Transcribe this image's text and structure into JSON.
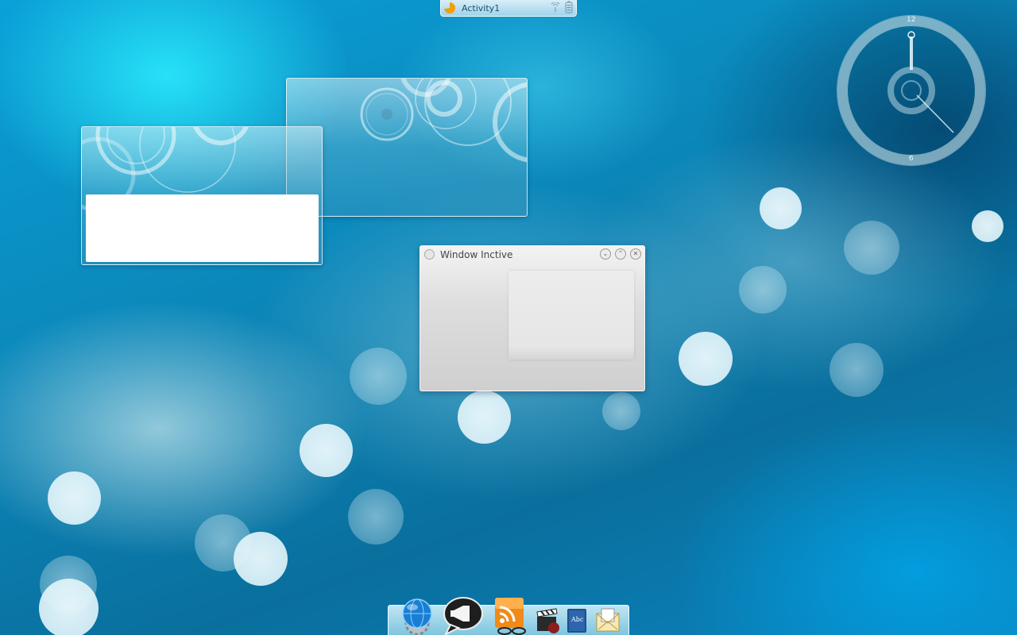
{
  "activity_bar": {
    "label": "Activity1",
    "icons": [
      "activity-switcher-icon",
      "network-icon",
      "battery-icon"
    ]
  },
  "clock": {
    "label_top": "12",
    "label_bottom": "6",
    "hands": {
      "hour": "12",
      "minute": "22"
    }
  },
  "windows": {
    "inactive": {
      "title": "Window Inctive",
      "buttons": [
        "minimize-icon",
        "maximize-icon",
        "close-icon"
      ]
    }
  },
  "dock": {
    "items": [
      "browser-globe-icon",
      "megaphone-chat-icon",
      "rss-feed-icon",
      "video-clapper-icon",
      "dictionary-book-icon",
      "mail-envelope-icon"
    ]
  }
}
